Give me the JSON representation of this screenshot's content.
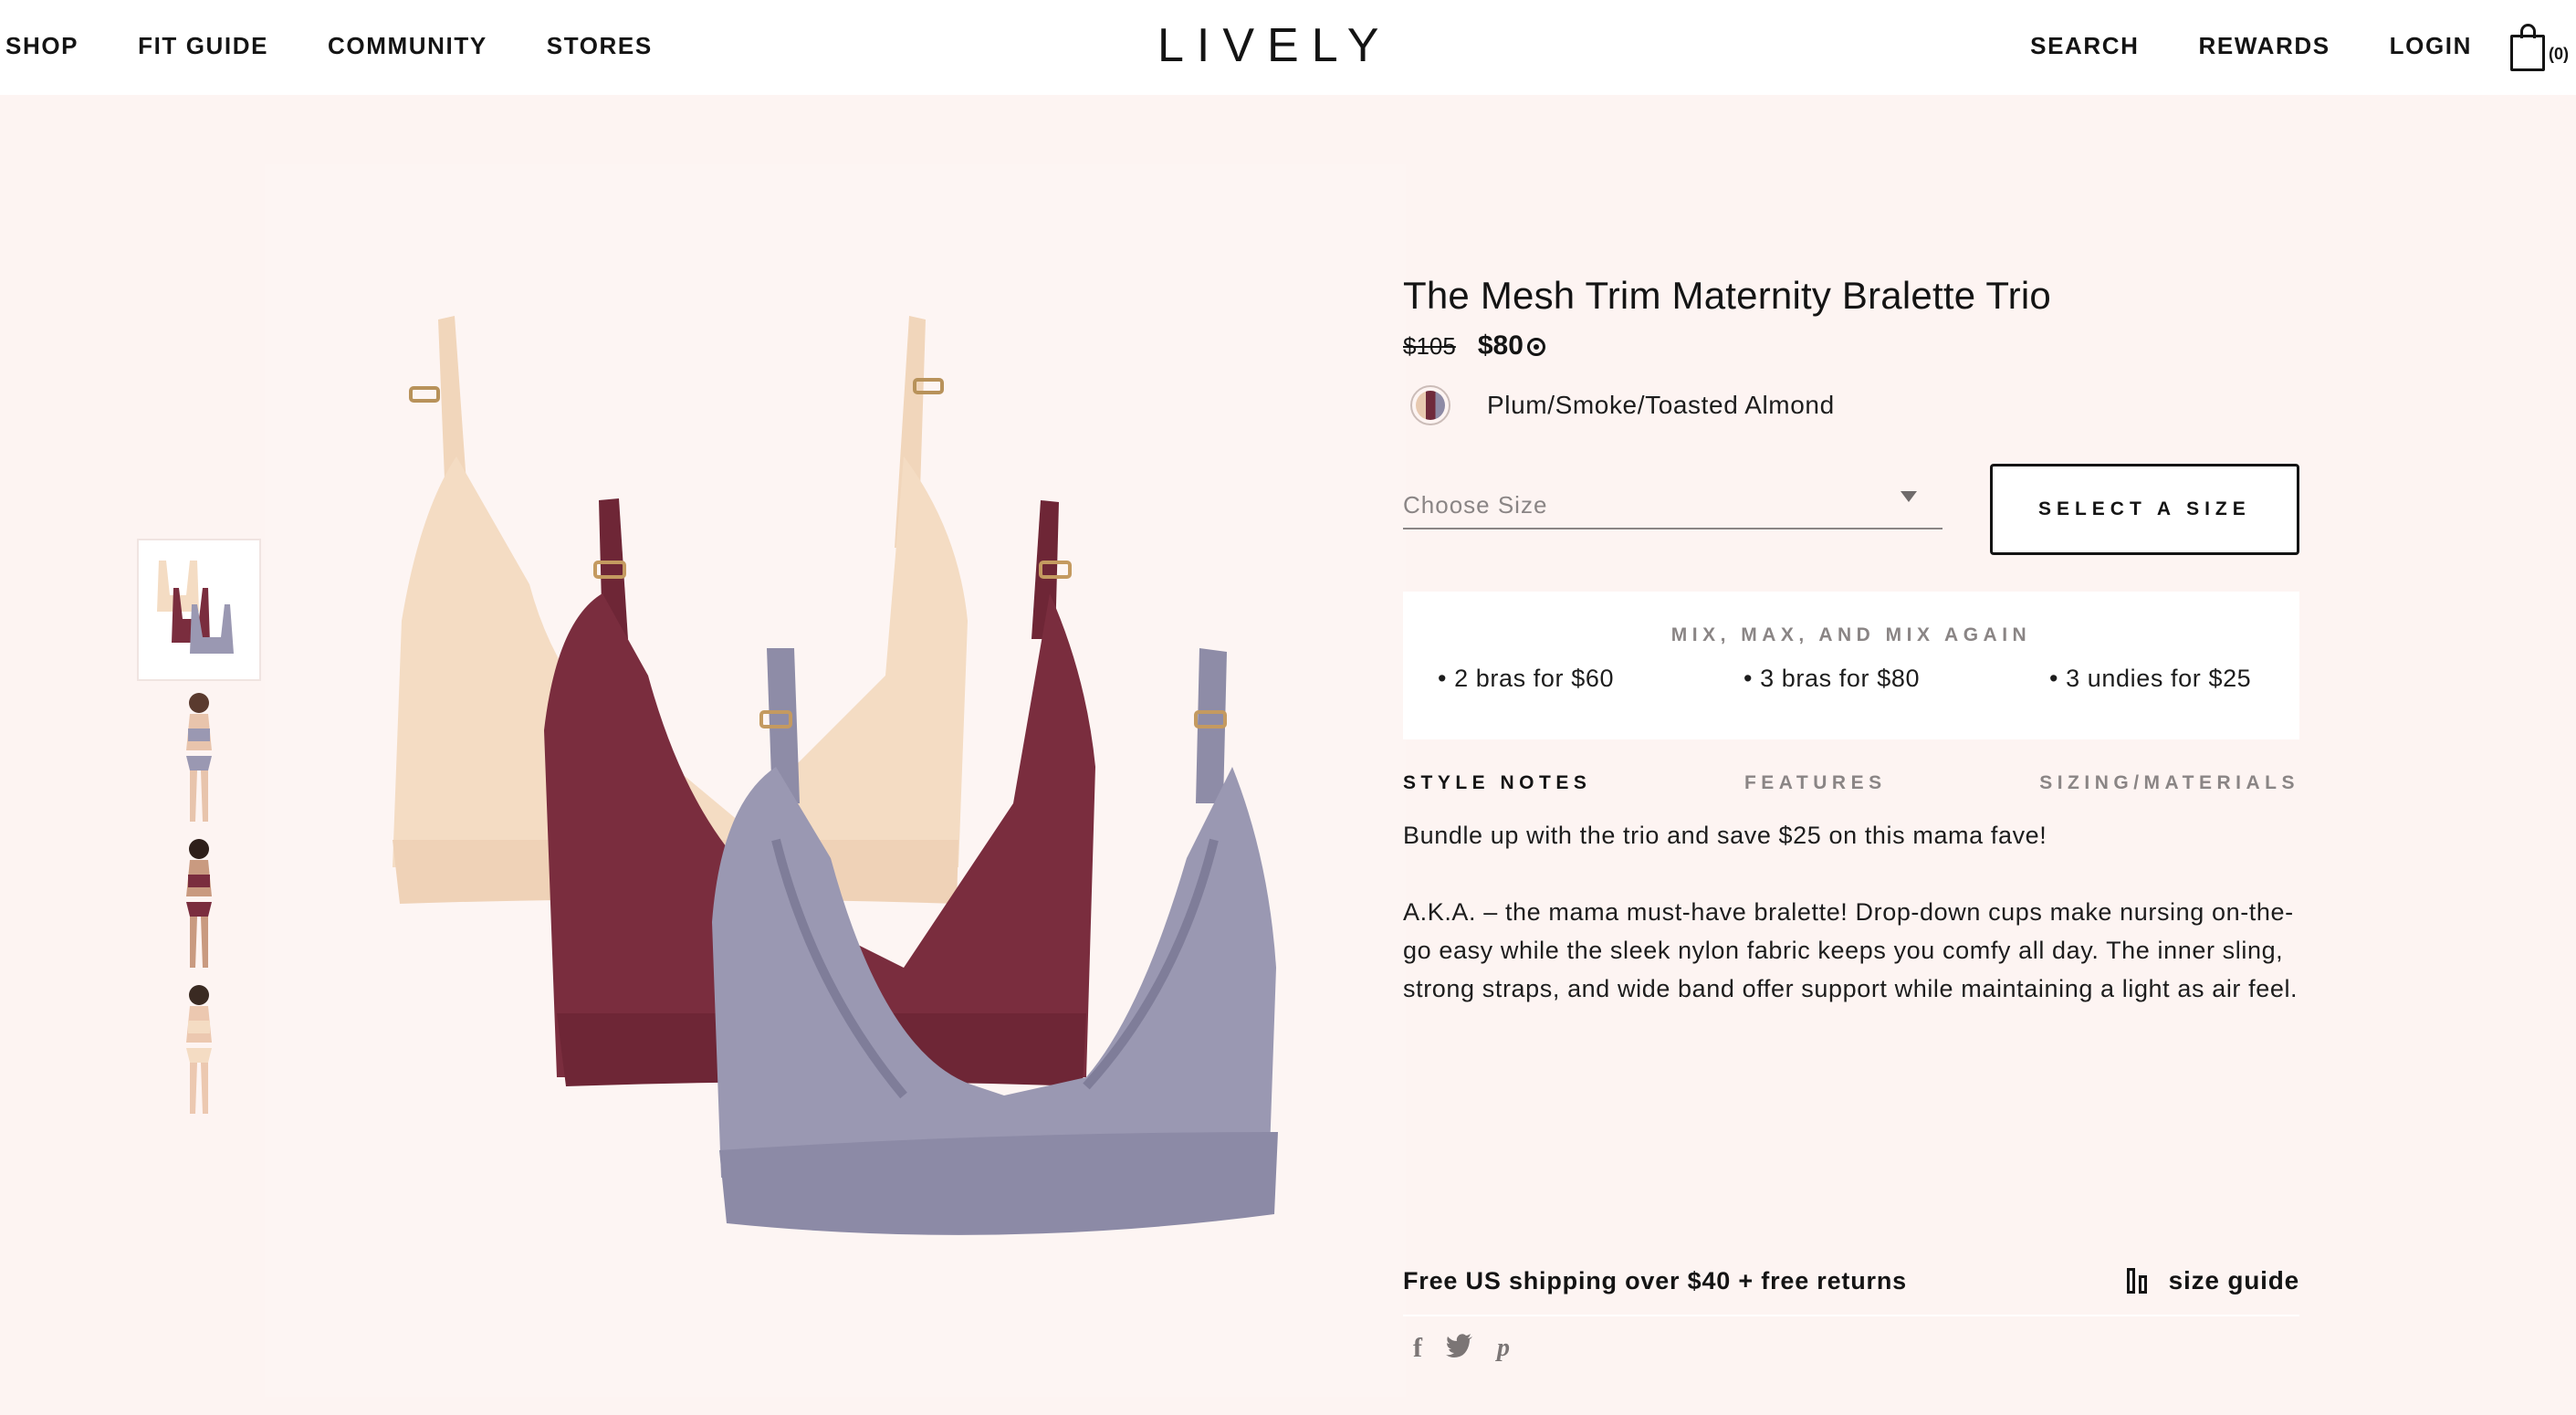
{
  "header": {
    "nav_left": [
      "SHOP",
      "FIT GUIDE",
      "COMMUNITY",
      "STORES"
    ],
    "logo": "LIVELY",
    "nav_right": [
      "SEARCH",
      "REWARDS",
      "LOGIN"
    ],
    "cart_count": "(0)",
    "cart_icon": "shopping-bag-icon"
  },
  "gallery": {
    "thumbnail_count": 4,
    "active_index": 0,
    "colors": {
      "almond": "#f4dcc3",
      "plum": "#7a2d3e",
      "smoke": "#9a98b2",
      "background": "#fdf4f2"
    }
  },
  "product": {
    "title": "The Mesh Trim Maternity Bralette Trio",
    "price_original": "$105",
    "price_sale": "$80",
    "color_name": "Plum/Smoke/Toasted Almond",
    "size_select": {
      "placeholder": "Choose Size"
    },
    "select_button": "SELECT A SIZE"
  },
  "promo": {
    "title": "MIX, MAX, AND MIX AGAIN",
    "items": [
      "2 bras for $60",
      "3 bras for $80",
      "3 undies for $25"
    ]
  },
  "tabs": [
    "STYLE NOTES",
    "FEATURES",
    "SIZING/MATERIALS"
  ],
  "active_tab": 0,
  "description": {
    "paragraph_1": "Bundle up with the trio and save $25 on this mama fave!",
    "paragraph_2": "A.K.A. – the mama must-have bralette! Drop-down cups make nursing on-the-go easy while the sleek nylon fabric keeps you comfy all day. The inner sling, strong straps, and wide band offer support while maintaining a light as air feel."
  },
  "footer_info": {
    "shipping": "Free US shipping over $40 + free returns",
    "size_guide": "size guide"
  },
  "social": {
    "facebook": "f",
    "twitter": "🐦",
    "pinterest": "p"
  }
}
